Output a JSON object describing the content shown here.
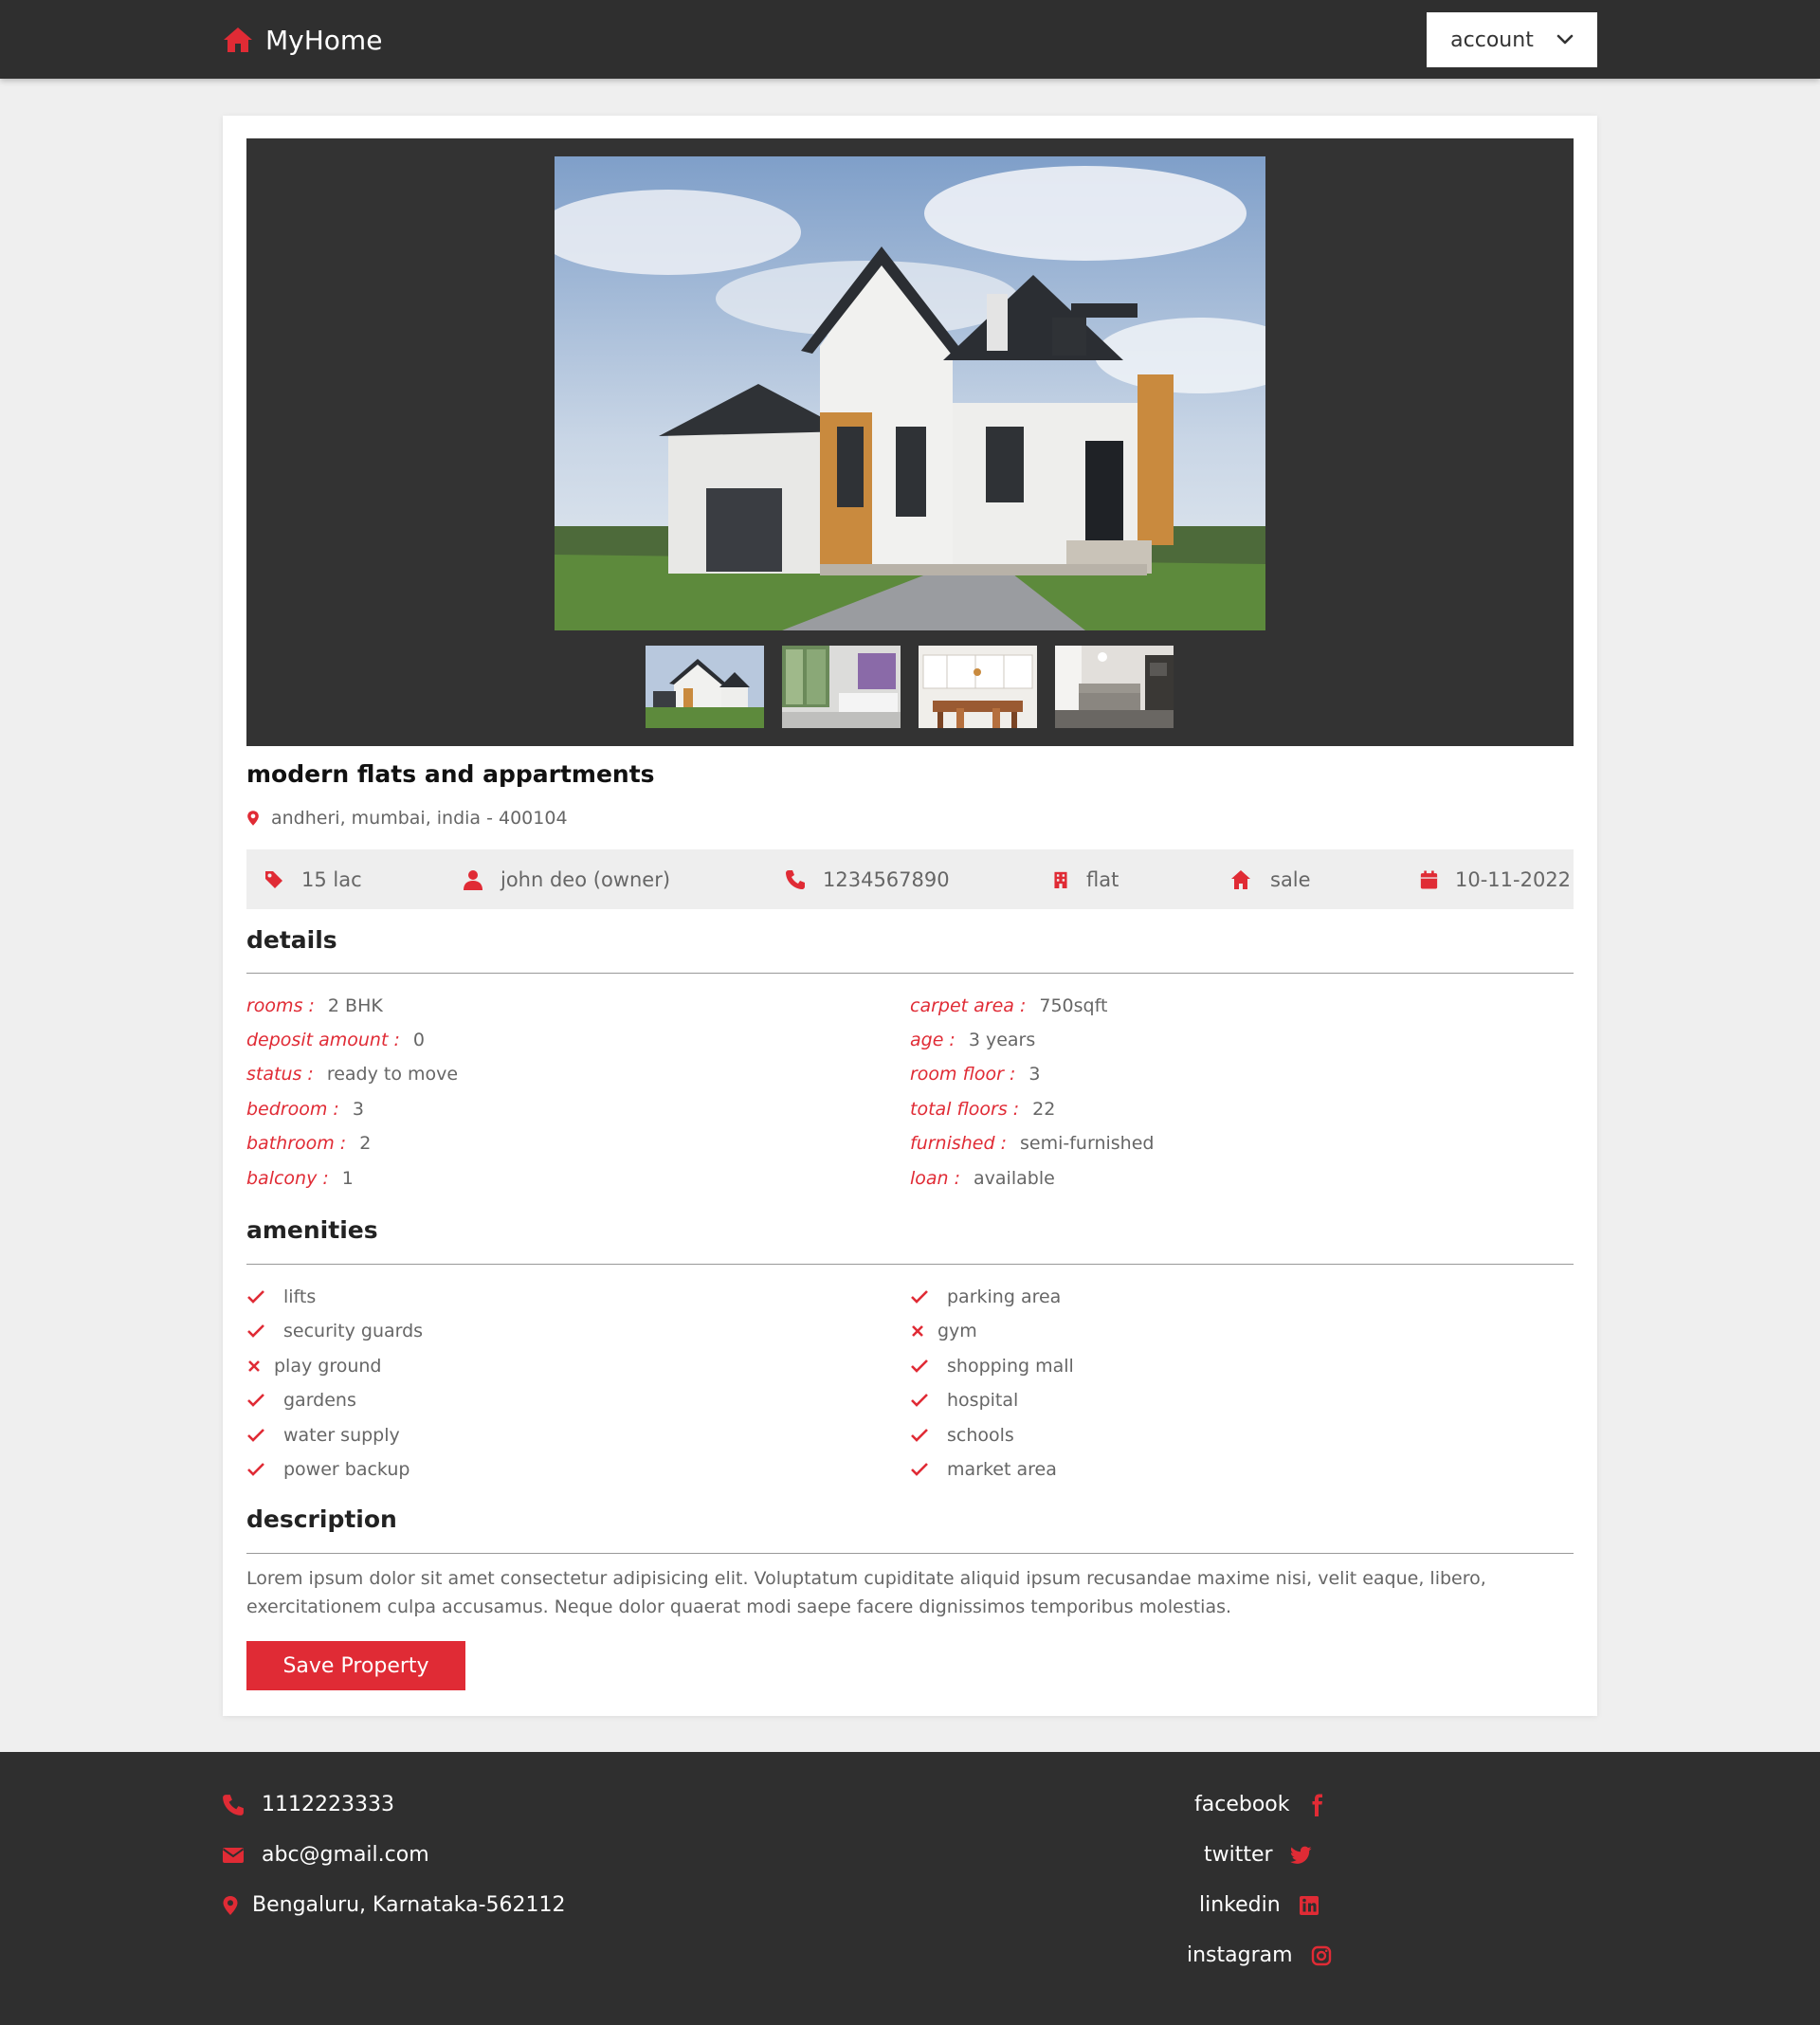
{
  "header": {
    "brand": "MyHome",
    "account_label": "account"
  },
  "property": {
    "title": "modern flats and appartments",
    "address": "andheri, mumbai, india - 400104",
    "price": "15 lac",
    "owner": "john deo (owner)",
    "phone": "1234567890",
    "type": "flat",
    "offer": "sale",
    "date": "10-11-2022"
  },
  "details": {
    "title": "details",
    "left": [
      {
        "key": "rooms :",
        "value": "2 BHK"
      },
      {
        "key": "deposit amount :",
        "value": "0"
      },
      {
        "key": "status :",
        "value": "ready to move"
      },
      {
        "key": "bedroom :",
        "value": "3"
      },
      {
        "key": "bathroom :",
        "value": "2"
      },
      {
        "key": "balcony :",
        "value": "1"
      }
    ],
    "right": [
      {
        "key": "carpet area :",
        "value": "750sqft"
      },
      {
        "key": "age :",
        "value": "3 years"
      },
      {
        "key": "room floor :",
        "value": "3"
      },
      {
        "key": "total floors :",
        "value": "22"
      },
      {
        "key": "furnished :",
        "value": "semi-furnished"
      },
      {
        "key": "loan :",
        "value": "available"
      }
    ]
  },
  "amenities": {
    "title": "amenities",
    "left": [
      {
        "label": "lifts",
        "available": true
      },
      {
        "label": "security guards",
        "available": true
      },
      {
        "label": "play ground",
        "available": false
      },
      {
        "label": "gardens",
        "available": true
      },
      {
        "label": "water supply",
        "available": true
      },
      {
        "label": "power backup",
        "available": true
      }
    ],
    "right": [
      {
        "label": "parking area",
        "available": true
      },
      {
        "label": "gym",
        "available": false
      },
      {
        "label": "shopping mall",
        "available": true
      },
      {
        "label": "hospital",
        "available": true
      },
      {
        "label": "schools",
        "available": true
      },
      {
        "label": "market area",
        "available": true
      }
    ]
  },
  "description": {
    "title": "description",
    "text": "Lorem ipsum dolor sit amet consectetur adipisicing elit. Voluptatum cupiditate aliquid ipsum recusandae maxime nisi, velit eaque, libero, exercitationem culpa accusamus. Neque dolor quaerat modi saepe facere dignissimos temporibus molestias."
  },
  "save_button": "Save Property",
  "footer": {
    "phone": "1112223333",
    "email": "abc@gmail.com",
    "address": "Bengaluru, Karnataka-562112",
    "socials": [
      "facebook",
      "twitter",
      "linkedin",
      "instagram"
    ]
  },
  "icons": {
    "brand": "house-icon",
    "account": "chevron-down-icon",
    "location": "map-marker-icon",
    "price": "tag-icon",
    "owner": "user-icon",
    "phone": "phone-icon",
    "type": "building-icon",
    "offer": "house-icon",
    "date": "calendar-icon",
    "available": "check-icon",
    "unavailable": "cross-icon",
    "email": "envelope-icon",
    "facebook": "facebook-icon",
    "twitter": "twitter-icon",
    "linkedin": "linkedin-icon",
    "instagram": "instagram-icon"
  },
  "colors": {
    "accent": "#e02b35",
    "header_bg": "#2f2f2f",
    "page_bg": "#efefef",
    "gallery_bg": "#333333",
    "info_bar_bg": "#eeeeee"
  }
}
